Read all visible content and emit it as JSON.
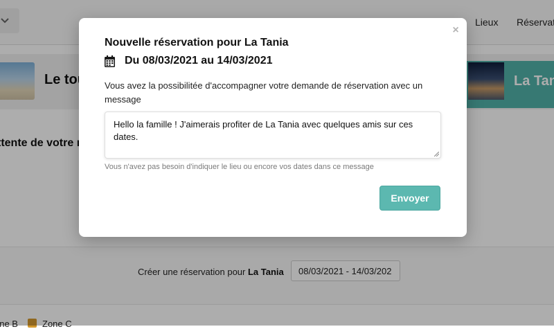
{
  "background": {
    "nav": {
      "link_lieux": "Lieux",
      "link_reservations": "Réservati"
    },
    "band": {
      "title_left": "Le tou",
      "title_right": "La Tania"
    },
    "waiting_text": "ttente de votre r",
    "create": {
      "label_prefix": "Créer une réservation pour",
      "label_place": "La Tania",
      "date_range": "08/03/2021 - 14/03/202"
    },
    "zones": {
      "zone_b": "one B",
      "zone_c": "Zone C"
    }
  },
  "modal": {
    "close": "×",
    "title": "Nouvelle réservation pour La Tania",
    "dates": "Du 08/03/2021 au 14/03/2021",
    "intro": "Vous avez la possibilitée d'accompagner votre demande de réservation avec un message",
    "message_value": "Hello la famille ! J'aimerais profiter  de La Tania avec quelques amis sur ces dates.",
    "help": "Vous n'avez pas besoin d'indiquer le lieu ou encore vos dates dans ce message",
    "send_label": "Envoyer"
  },
  "icons": {
    "calendar": "calendar-icon",
    "chevron": "chevron-down-icon",
    "close": "close-icon"
  },
  "colors": {
    "accent": "#5cb8b0",
    "teal_card": "#52b3aa",
    "checkbox": "#d3992f",
    "overlay": "rgba(0,0,0,0.32)"
  }
}
